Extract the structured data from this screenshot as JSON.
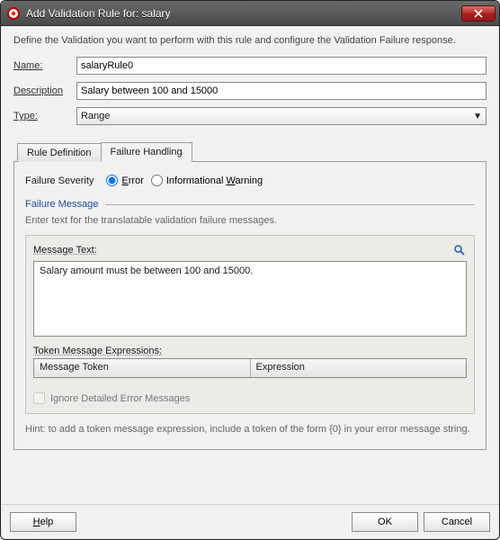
{
  "titlebar": {
    "title": "Add Validation Rule for: salary"
  },
  "intro": "Define the Validation you want to perform with this rule and configure the Validation Failure response.",
  "form": {
    "name_label": "Name:",
    "name_value": "salaryRule0",
    "desc_label": "Description",
    "desc_value": "Salary between 100 and 15000",
    "type_label": "Type:",
    "type_value": "Range"
  },
  "tabs": {
    "rule_definition": "Rule Definition",
    "failure_handling": "Failure Handling"
  },
  "severity": {
    "label": "Failure Severity",
    "error": "Error",
    "warning": "Informational Warning"
  },
  "failure_msg": {
    "title": "Failure Message",
    "desc": "Enter text for the translatable validation failure messages.",
    "msg_label": "Message Text:",
    "msg_value": "Salary amount must be between 100 and 15000.",
    "token_label": "Token Message Expressions:",
    "col_token": "Message Token",
    "col_expr": "Expression",
    "ignore": "Ignore Detailed Error Messages"
  },
  "hint": "Hint: to add a token message expression, include a token of the form {0} in your error message string.",
  "footer": {
    "help": "Help",
    "ok": "OK",
    "cancel": "Cancel"
  }
}
